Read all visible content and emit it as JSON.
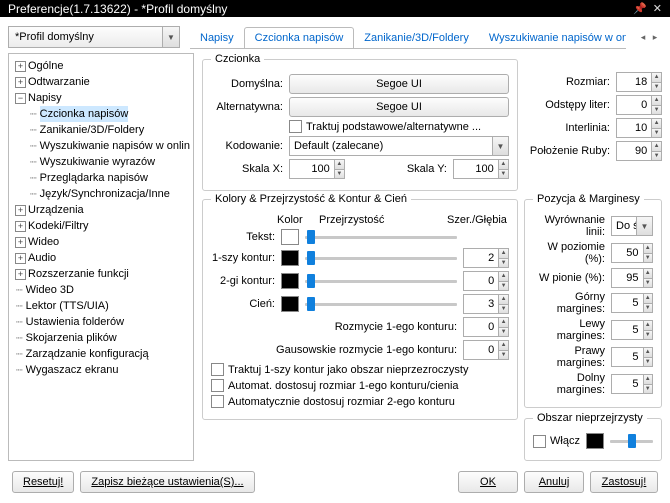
{
  "title": "Preferencje(1.7.13622) - *Profil domyślny",
  "profile": "*Profil domyślny",
  "tabs": [
    "Napisy",
    "Czcionka napisów",
    "Zanikanie/3D/Foldery",
    "Wyszukiwanie napisów w onli"
  ],
  "active_tab": 1,
  "tree": {
    "items": [
      {
        "expander": "+",
        "label": "Ogólne",
        "indent": 0
      },
      {
        "expander": "+",
        "label": "Odtwarzanie",
        "indent": 0
      },
      {
        "expander": "-",
        "label": "Napisy",
        "indent": 0
      },
      {
        "label": "Czcionka napisów",
        "indent": 1,
        "hl": true
      },
      {
        "label": "Zanikanie/3D/Foldery",
        "indent": 1
      },
      {
        "label": "Wyszukiwanie napisów w onlin",
        "indent": 1
      },
      {
        "label": "Wyszukiwanie wyrazów",
        "indent": 1
      },
      {
        "label": "Przeglądarka napisów",
        "indent": 1
      },
      {
        "label": "Język/Synchronizacja/Inne",
        "indent": 1
      },
      {
        "expander": "+",
        "label": "Urządzenia",
        "indent": 0
      },
      {
        "expander": "+",
        "label": "Kodeki/Filtry",
        "indent": 0
      },
      {
        "expander": "+",
        "label": "Wideo",
        "indent": 0
      },
      {
        "expander": "+",
        "label": "Audio",
        "indent": 0
      },
      {
        "expander": "+",
        "label": "Rozszerzanie funkcji",
        "indent": 0
      },
      {
        "label": "Wideo 3D",
        "indent": 0
      },
      {
        "label": "Lektor (TTS/UIA)",
        "indent": 0
      },
      {
        "label": "Ustawienia folderów",
        "indent": 0
      },
      {
        "label": "Skojarzenia plików",
        "indent": 0
      },
      {
        "label": "Zarządzanie konfiguracją",
        "indent": 0
      },
      {
        "label": "Wygaszacz ekranu",
        "indent": 0
      }
    ]
  },
  "font": {
    "legend": "Czcionka",
    "default_lbl": "Domyślna:",
    "default_val": "Segoe UI",
    "alt_lbl": "Alternatywna:",
    "alt_val": "Segoe UI",
    "treat_chk": "Traktuj podstawowe/alternatywne ...",
    "encoding_lbl": "Kodowanie:",
    "encoding_val": "Default (zalecane)",
    "scalex_lbl": "Skala X:",
    "scalex_val": "100",
    "scaley_lbl": "Skala Y:",
    "scaley_val": "100",
    "size_lbl": "Rozmiar:",
    "size_val": "18",
    "letter_lbl": "Odstępy liter:",
    "letter_val": "0",
    "interline_lbl": "Interlinia:",
    "interline_val": "10",
    "ruby_lbl": "Położenie Ruby:",
    "ruby_val": "90"
  },
  "colors": {
    "legend": "Kolory & Przejrzystość & Kontur & Cień",
    "hdr_color": "Kolor",
    "hdr_trans": "Przejrzystość",
    "hdr_depth": "Szer./Głębia",
    "text_lbl": "Tekst:",
    "c1_lbl": "1-szy kontur:",
    "c1_val": "2",
    "c2_lbl": "2-gi kontur:",
    "c2_val": "0",
    "shadow_lbl": "Cień:",
    "shadow_val": "3",
    "blur1_lbl": "Rozmycie 1-ego konturu:",
    "blur1_val": "0",
    "gauss_lbl": "Gausowskie rozmycie 1-ego konturu:",
    "gauss_val": "0",
    "chk1": "Traktuj 1-szy kontur jako obszar nieprzezroczysty",
    "chk2": "Automat. dostosuj rozmiar 1-ego konturu/cienia",
    "chk3": "Automatycznie dostosuj rozmiar 2-ego konturu"
  },
  "pos": {
    "legend": "Pozycja & Marginesy",
    "align_lbl": "Wyrównanie linii:",
    "align_val": "Do śr",
    "hpct_lbl": "W poziomie (%):",
    "hpct_val": "50",
    "vpct_lbl": "W pionie (%):",
    "vpct_val": "95",
    "top_lbl": "Górny margines:",
    "top_val": "5",
    "left_lbl": "Lewy margines:",
    "left_val": "5",
    "right_lbl": "Prawy margines:",
    "right_val": "5",
    "bottom_lbl": "Dolny margines:",
    "bottom_val": "5"
  },
  "opaque": {
    "legend": "Obszar nieprzejrzysty",
    "enable": "Włącz"
  },
  "buttons": {
    "reset": "Resetuj!",
    "save": "Zapisz bieżące ustawienia(S)...",
    "ok": "OK",
    "cancel": "Anuluj",
    "apply": "Zastosuj!"
  }
}
